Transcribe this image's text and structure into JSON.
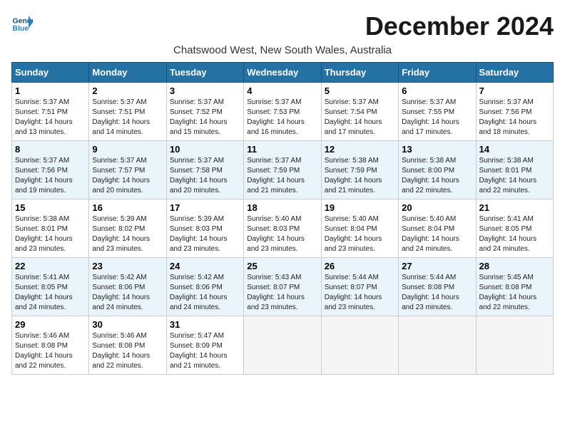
{
  "header": {
    "logo_general": "General",
    "logo_blue": "Blue",
    "month_title": "December 2024",
    "subtitle": "Chatswood West, New South Wales, Australia"
  },
  "weekdays": [
    "Sunday",
    "Monday",
    "Tuesday",
    "Wednesday",
    "Thursday",
    "Friday",
    "Saturday"
  ],
  "weeks": [
    [
      {
        "day": "1",
        "sunrise": "5:37 AM",
        "sunset": "7:51 PM",
        "daylight": "14 hours and 13 minutes."
      },
      {
        "day": "2",
        "sunrise": "5:37 AM",
        "sunset": "7:51 PM",
        "daylight": "14 hours and 14 minutes."
      },
      {
        "day": "3",
        "sunrise": "5:37 AM",
        "sunset": "7:52 PM",
        "daylight": "14 hours and 15 minutes."
      },
      {
        "day": "4",
        "sunrise": "5:37 AM",
        "sunset": "7:53 PM",
        "daylight": "14 hours and 16 minutes."
      },
      {
        "day": "5",
        "sunrise": "5:37 AM",
        "sunset": "7:54 PM",
        "daylight": "14 hours and 17 minutes."
      },
      {
        "day": "6",
        "sunrise": "5:37 AM",
        "sunset": "7:55 PM",
        "daylight": "14 hours and 17 minutes."
      },
      {
        "day": "7",
        "sunrise": "5:37 AM",
        "sunset": "7:56 PM",
        "daylight": "14 hours and 18 minutes."
      }
    ],
    [
      {
        "day": "8",
        "sunrise": "5:37 AM",
        "sunset": "7:56 PM",
        "daylight": "14 hours and 19 minutes."
      },
      {
        "day": "9",
        "sunrise": "5:37 AM",
        "sunset": "7:57 PM",
        "daylight": "14 hours and 20 minutes."
      },
      {
        "day": "10",
        "sunrise": "5:37 AM",
        "sunset": "7:58 PM",
        "daylight": "14 hours and 20 minutes."
      },
      {
        "day": "11",
        "sunrise": "5:37 AM",
        "sunset": "7:59 PM",
        "daylight": "14 hours and 21 minutes."
      },
      {
        "day": "12",
        "sunrise": "5:38 AM",
        "sunset": "7:59 PM",
        "daylight": "14 hours and 21 minutes."
      },
      {
        "day": "13",
        "sunrise": "5:38 AM",
        "sunset": "8:00 PM",
        "daylight": "14 hours and 22 minutes."
      },
      {
        "day": "14",
        "sunrise": "5:38 AM",
        "sunset": "8:01 PM",
        "daylight": "14 hours and 22 minutes."
      }
    ],
    [
      {
        "day": "15",
        "sunrise": "5:38 AM",
        "sunset": "8:01 PM",
        "daylight": "14 hours and 23 minutes."
      },
      {
        "day": "16",
        "sunrise": "5:39 AM",
        "sunset": "8:02 PM",
        "daylight": "14 hours and 23 minutes."
      },
      {
        "day": "17",
        "sunrise": "5:39 AM",
        "sunset": "8:03 PM",
        "daylight": "14 hours and 23 minutes."
      },
      {
        "day": "18",
        "sunrise": "5:40 AM",
        "sunset": "8:03 PM",
        "daylight": "14 hours and 23 minutes."
      },
      {
        "day": "19",
        "sunrise": "5:40 AM",
        "sunset": "8:04 PM",
        "daylight": "14 hours and 23 minutes."
      },
      {
        "day": "20",
        "sunrise": "5:40 AM",
        "sunset": "8:04 PM",
        "daylight": "14 hours and 24 minutes."
      },
      {
        "day": "21",
        "sunrise": "5:41 AM",
        "sunset": "8:05 PM",
        "daylight": "14 hours and 24 minutes."
      }
    ],
    [
      {
        "day": "22",
        "sunrise": "5:41 AM",
        "sunset": "8:05 PM",
        "daylight": "14 hours and 24 minutes."
      },
      {
        "day": "23",
        "sunrise": "5:42 AM",
        "sunset": "8:06 PM",
        "daylight": "14 hours and 24 minutes."
      },
      {
        "day": "24",
        "sunrise": "5:42 AM",
        "sunset": "8:06 PM",
        "daylight": "14 hours and 24 minutes."
      },
      {
        "day": "25",
        "sunrise": "5:43 AM",
        "sunset": "8:07 PM",
        "daylight": "14 hours and 23 minutes."
      },
      {
        "day": "26",
        "sunrise": "5:44 AM",
        "sunset": "8:07 PM",
        "daylight": "14 hours and 23 minutes."
      },
      {
        "day": "27",
        "sunrise": "5:44 AM",
        "sunset": "8:08 PM",
        "daylight": "14 hours and 23 minutes."
      },
      {
        "day": "28",
        "sunrise": "5:45 AM",
        "sunset": "8:08 PM",
        "daylight": "14 hours and 22 minutes."
      }
    ],
    [
      {
        "day": "29",
        "sunrise": "5:46 AM",
        "sunset": "8:08 PM",
        "daylight": "14 hours and 22 minutes."
      },
      {
        "day": "30",
        "sunrise": "5:46 AM",
        "sunset": "8:08 PM",
        "daylight": "14 hours and 22 minutes."
      },
      {
        "day": "31",
        "sunrise": "5:47 AM",
        "sunset": "8:09 PM",
        "daylight": "14 hours and 21 minutes."
      },
      null,
      null,
      null,
      null
    ]
  ]
}
